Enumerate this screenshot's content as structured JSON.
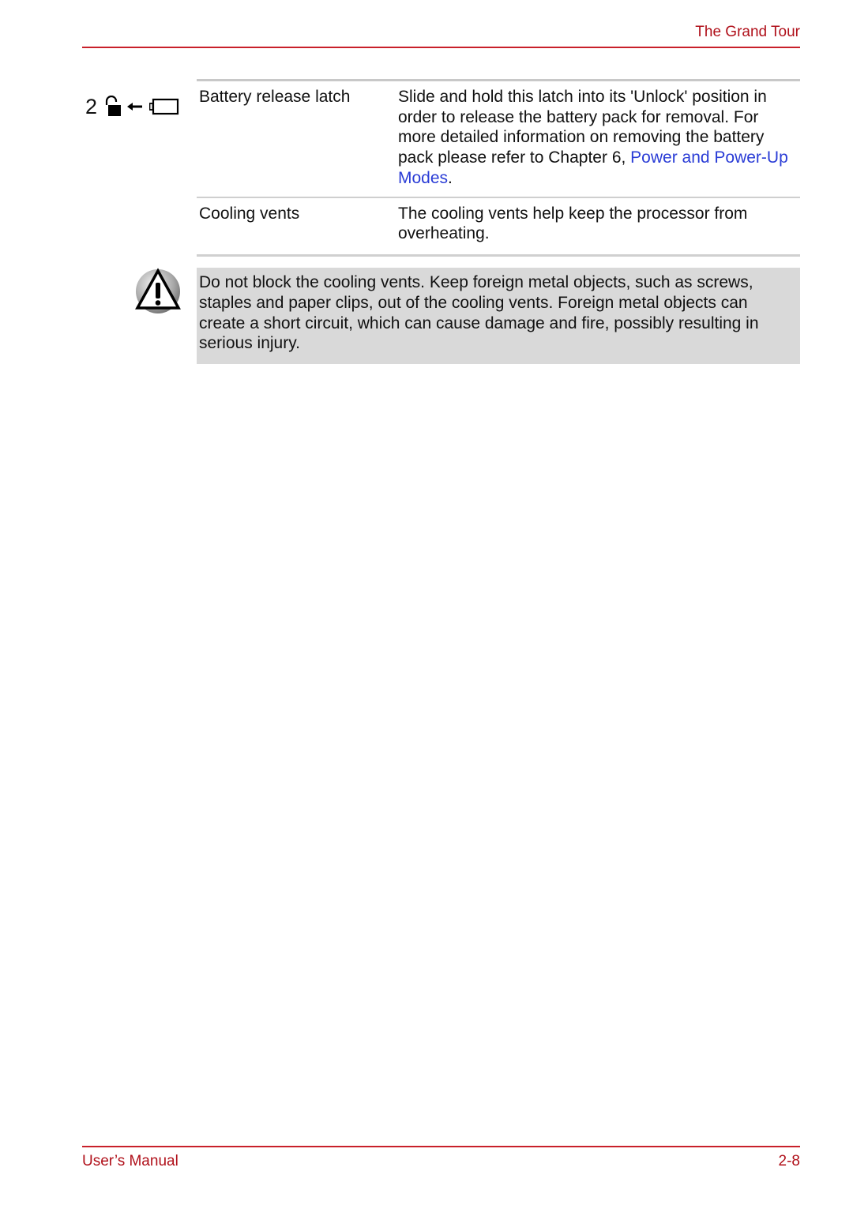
{
  "header": {
    "section_title": "The Grand Tour"
  },
  "table": {
    "rows": [
      {
        "index_label": "2",
        "icons": [
          "unlock-icon",
          "arrow-left-icon",
          "battery-icon"
        ],
        "term": "Battery release latch",
        "description": "Slide and hold this latch into its 'Unlock' position in order to release the battery pack for removal. For more detailed information on removing the battery pack please refer to Chapter 6, ",
        "link_text": "Power and Power-Up Modes",
        "trailing": "."
      },
      {
        "term": "Cooling vents",
        "description": "The cooling vents help keep the processor from overheating."
      }
    ]
  },
  "warning": {
    "icon": "warning-icon",
    "text": "Do not block the cooling vents. Keep foreign metal objects, such as screws, staples and paper clips, out of the cooling vents. Foreign metal objects can create a short circuit, which can cause damage and fire, possibly resulting in serious injury."
  },
  "footer": {
    "left": "User’s Manual",
    "page_number": "2-8"
  },
  "colors": {
    "accent": "#b0101a",
    "link": "#2a3cd6",
    "warning_background": "#d9d9d9"
  }
}
